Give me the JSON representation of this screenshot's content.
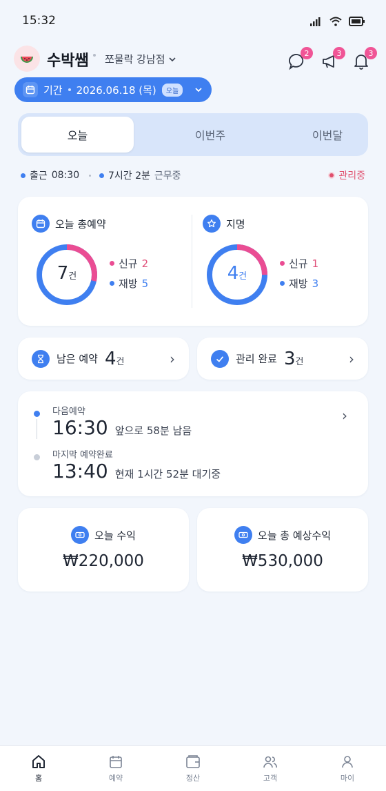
{
  "status_bar": {
    "time": "15:32"
  },
  "header": {
    "avatar_icon": "watermelon-icon",
    "shop_name": "수박쌤",
    "branch": "쪼물락 강남점",
    "message_count": "2",
    "announce_count": "3",
    "notification_count": "3"
  },
  "period": {
    "label": "기간",
    "date": "2026.06.18 (목)",
    "chip": "오늘"
  },
  "tabs": [
    "오늘",
    "이번주",
    "이번달"
  ],
  "work": {
    "clock_in_label": "출근",
    "clock_in_time": "08:30",
    "duration": "7시간 2분",
    "duration_suffix": "근무중",
    "status": "관리중"
  },
  "summary": {
    "total": {
      "title": "오늘 총예약",
      "count": "7",
      "unit": "건",
      "new_label": "신규",
      "new_value": "2",
      "return_label": "재방",
      "return_value": "5",
      "new_fraction": 0.2857
    },
    "named": {
      "title": "지명",
      "count": "4",
      "unit": "건",
      "new_label": "신규",
      "new_value": "1",
      "return_label": "재방",
      "return_value": "3",
      "new_fraction": 0.25
    }
  },
  "remaining": {
    "label": "남은 예약",
    "count": "4",
    "unit": "건"
  },
  "completed": {
    "label": "관리 완료",
    "count": "3",
    "unit": "건"
  },
  "schedule": {
    "next_label": "다음예약",
    "next_time": "16:30",
    "next_note": "앞으로 58분 남음",
    "last_label": "마지막 예약완료",
    "last_time": "13:40",
    "last_note": "현재 1시간 52분 대기중"
  },
  "revenue": {
    "today_label": "오늘 수익",
    "today_value": "₩220,000",
    "expected_label": "오늘 총 예상수익",
    "expected_value": "₩530,000"
  },
  "nav": [
    "홈",
    "예약",
    "정산",
    "고객",
    "마이"
  ],
  "colors": {
    "accent": "#3f7ff0",
    "pink": "#ea4d93",
    "light_blue": "#d8e5fa"
  }
}
